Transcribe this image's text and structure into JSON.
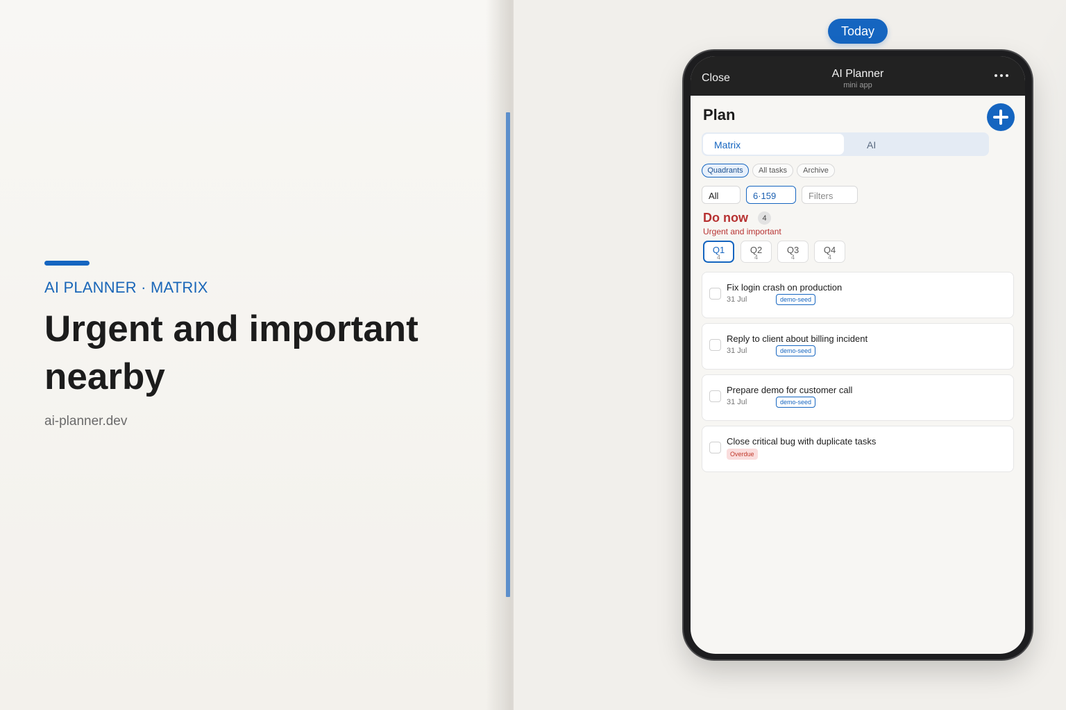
{
  "hero": {
    "eyebrow": "AI PLANNER · MATRIX",
    "headline": "Urgent and important nearby",
    "url": "ai-planner.dev"
  },
  "today_label": "Today",
  "app": {
    "close_label": "Close",
    "title": "AI Planner",
    "subtitle": "mini app",
    "page_title": "Plan",
    "segments": {
      "matrix": "Matrix",
      "ai": "AI"
    },
    "chips": [
      "Quadrants",
      "All tasks",
      "Archive"
    ],
    "filters": {
      "scope": "All",
      "range": "6·159",
      "filters_placeholder": "Filters"
    },
    "section": {
      "title": "Do now",
      "count": "4",
      "subtitle": "Urgent and important"
    },
    "quadrants": [
      {
        "label": "Q1",
        "count": "4"
      },
      {
        "label": "Q2",
        "count": "4"
      },
      {
        "label": "Q3",
        "count": "4"
      },
      {
        "label": "Q4",
        "count": "4"
      }
    ],
    "tasks": [
      {
        "title": "Fix login crash on production",
        "date": "31 Jul",
        "tag": "demo-seed"
      },
      {
        "title": "Reply to client about billing incident",
        "date": "31 Jul",
        "tag": "demo-seed"
      },
      {
        "title": "Prepare demo for customer call",
        "date": "31 Jul",
        "tag": "demo-seed"
      },
      {
        "title": "Close critical bug with duplicate tasks",
        "status": "Overdue"
      }
    ]
  },
  "colors": {
    "accent": "#1565c0",
    "danger": "#b73232",
    "topbar": "#222222",
    "overdue_bg": "#fadddd"
  }
}
